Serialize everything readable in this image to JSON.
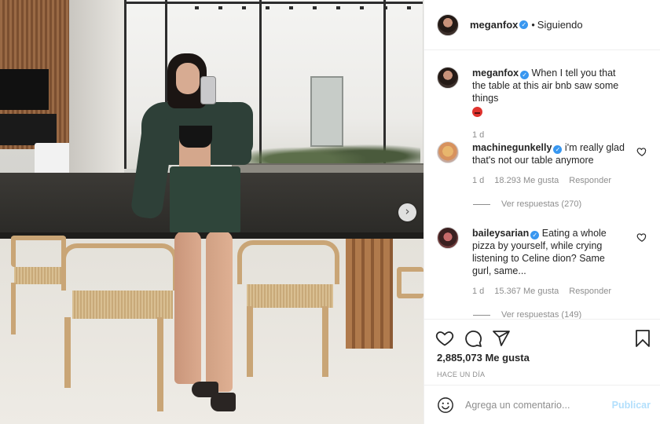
{
  "post": {
    "author": {
      "username": "meganfox",
      "verified": true
    },
    "follow_label": "Siguiendo",
    "caption": {
      "username": "meganfox",
      "text": "When I tell you that the table at this air bnb saw some things",
      "emoji": "angry-face",
      "time": "1 d"
    },
    "comments": [
      {
        "username": "machinegunkelly",
        "verified": true,
        "text": "i'm really glad that's not our table anymore",
        "time": "1 d",
        "likes": "18.293 Me gusta",
        "reply_label": "Responder",
        "view_replies": "Ver respuestas (270)"
      },
      {
        "username": "baileysarian",
        "verified": true,
        "text": "Eating a whole pizza by yourself, while crying listening to Celine dion? Same gurl, same...",
        "time": "1 d",
        "likes": "15.367 Me gusta",
        "reply_label": "Responder",
        "view_replies": "Ver respuestas (149)"
      }
    ],
    "like_count": "2,885,073",
    "like_label": "Me gusta",
    "timestamp": "HACE UN DÍA",
    "add_comment": {
      "placeholder": "Agrega un comentario...",
      "value": ""
    },
    "publish_label": "Publicar"
  },
  "icons": {
    "verified": "verified-badge-icon",
    "next": "chevron-right-icon",
    "like": "heart-icon",
    "comment": "comment-bubble-icon",
    "share": "paper-plane-icon",
    "save": "bookmark-icon",
    "emoji": "smiley-icon"
  },
  "colors": {
    "verified": "#3897f0",
    "link_disabled": "#b2dffc",
    "muted": "#8e8e8e",
    "text": "#262626"
  }
}
